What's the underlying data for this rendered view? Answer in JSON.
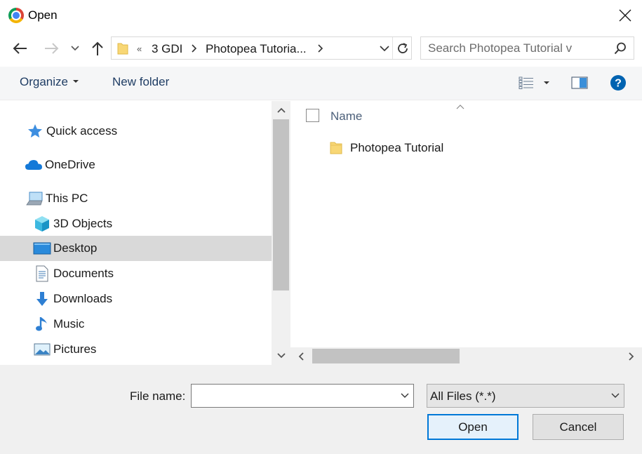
{
  "window": {
    "title": "Open",
    "close_label": "Close",
    "app_icon": "chrome-icon"
  },
  "navigation": {
    "back_icon": "back-arrow-icon",
    "forward_icon": "forward-arrow-icon",
    "recent_icon": "chevron-down-icon",
    "up_icon": "up-arrow-icon"
  },
  "address_bar": {
    "overflow": "«",
    "segments": [
      "3 GDI",
      "Photopea Tutoria..."
    ],
    "refresh_icon": "refresh-icon"
  },
  "search": {
    "placeholder": "Search Photopea Tutorial v",
    "icon": "search-icon"
  },
  "toolbar": {
    "organize_label": "Organize",
    "new_folder_label": "New folder",
    "view_icon": "details-view-icon",
    "preview_icon": "preview-pane-icon",
    "help_icon": "help-icon",
    "help_color": "#0063b1"
  },
  "sidebar": {
    "items": [
      {
        "label": "Quick access",
        "icon": "star-icon"
      },
      {
        "label": "OneDrive",
        "icon": "cloud-icon"
      },
      {
        "label": "This PC",
        "icon": "computer-icon"
      },
      {
        "label": "3D Objects",
        "icon": "cube-icon"
      },
      {
        "label": "Desktop",
        "icon": "desktop-icon",
        "selected": true
      },
      {
        "label": "Documents",
        "icon": "document-icon"
      },
      {
        "label": "Downloads",
        "icon": "download-icon"
      },
      {
        "label": "Music",
        "icon": "music-icon"
      },
      {
        "label": "Pictures",
        "icon": "pictures-icon"
      }
    ]
  },
  "file_list": {
    "column_name": "Name",
    "items": [
      {
        "name": "Photopea Tutorial",
        "icon": "folder-icon"
      }
    ]
  },
  "bottom": {
    "file_name_label": "File name:",
    "file_name_value": "",
    "filter_value": "All Files (*.*)",
    "open_label": "Open",
    "cancel_label": "Cancel"
  },
  "colors": {
    "accent": "#0078d7",
    "folder": "#f8d775",
    "selected_bg": "#d9d9d9",
    "toolbar_text": "#1f3d64"
  }
}
